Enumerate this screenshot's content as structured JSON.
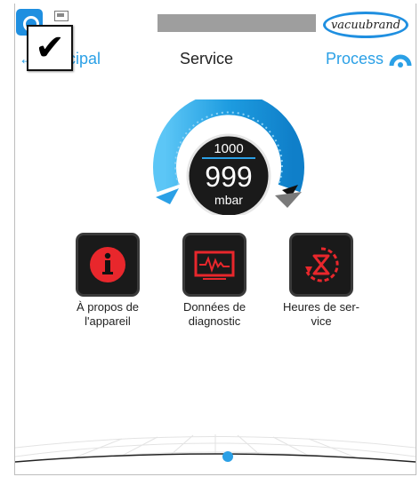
{
  "header": {
    "logo_text": "vacuubrand"
  },
  "nav": {
    "back_label": "principal",
    "title": "Service",
    "process_label": "Process"
  },
  "gauge": {
    "setpoint": "1000",
    "value": "999",
    "unit": "mbar",
    "fill_fraction": 0.999
  },
  "tiles": [
    {
      "label": "À propos de l'appareil",
      "icon": "info-icon"
    },
    {
      "label": "Données de diagnostic",
      "icon": "diagnostic-monitor-icon"
    },
    {
      "label": "Heures de ser- vice",
      "icon": "hourglass-icon"
    }
  ],
  "pagination": {
    "current": 1
  },
  "colors": {
    "accent": "#2ba0e6",
    "tile_bg": "#1a1a1a",
    "icon_red": "#e8272c",
    "gauge_blue": "#1e9ce0"
  }
}
